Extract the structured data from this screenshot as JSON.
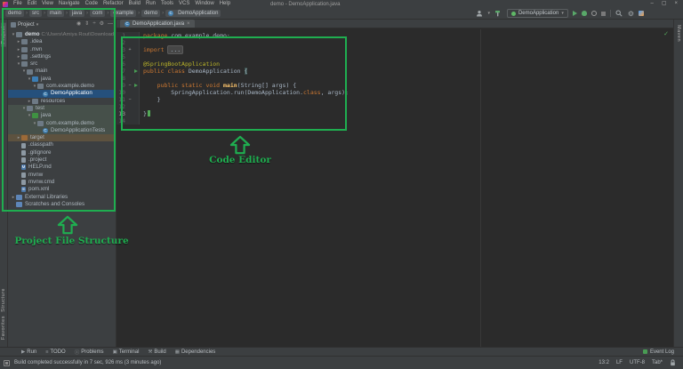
{
  "window": {
    "title": "demo - DemoApplication.java",
    "controls": [
      "minimize",
      "maximize",
      "close"
    ]
  },
  "menu": {
    "items": [
      "File",
      "Edit",
      "View",
      "Navigate",
      "Code",
      "Refactor",
      "Build",
      "Run",
      "Tools",
      "VCS",
      "Window",
      "Help"
    ]
  },
  "breadcrumbs": [
    "demo",
    "src",
    "main",
    "java",
    "com",
    "example",
    "demo",
    "DemoApplication"
  ],
  "toolbar": {
    "run_config": "DemoApplication",
    "icons": [
      "user",
      "build-hammer",
      "run",
      "debug",
      "coverage",
      "stop",
      "search",
      "settings",
      "plugins"
    ]
  },
  "left_stripe": {
    "top": "Project",
    "bottom": [
      "Structure",
      "Favorites"
    ]
  },
  "right_stripe": {
    "top": "Maven"
  },
  "project_panel": {
    "header": "Project",
    "header_icons": [
      "locate",
      "expand",
      "collapse",
      "settings",
      "hide"
    ],
    "tree": [
      {
        "label": "demo",
        "path": "C:\\Users\\Amiya Rout\\Downloads\\demo",
        "icon": "folder",
        "indent": 0,
        "chevron": "open",
        "bold": true
      },
      {
        "label": ".idea",
        "icon": "folder",
        "indent": 1,
        "chevron": "closed"
      },
      {
        "label": ".mvn",
        "icon": "folder",
        "indent": 1,
        "chevron": "closed"
      },
      {
        "label": ".settings",
        "icon": "folder",
        "indent": 1,
        "chevron": "closed"
      },
      {
        "label": "src",
        "icon": "folder",
        "indent": 1,
        "chevron": "open"
      },
      {
        "label": "main",
        "icon": "folder",
        "indent": 2,
        "chevron": "open"
      },
      {
        "label": "java",
        "icon": "folder-src",
        "indent": 3,
        "chevron": "open"
      },
      {
        "label": "com.example.demo",
        "icon": "package",
        "indent": 4,
        "chevron": "open"
      },
      {
        "label": "DemoApplication",
        "icon": "class",
        "indent": 5,
        "selected": true
      },
      {
        "label": "resources",
        "icon": "folder",
        "indent": 3,
        "chevron": "closed"
      },
      {
        "label": "test",
        "icon": "folder",
        "indent": 2,
        "chevron": "open",
        "tint": "test"
      },
      {
        "label": "java",
        "icon": "folder-test",
        "indent": 3,
        "chevron": "open",
        "tint": "test"
      },
      {
        "label": "com.example.demo",
        "icon": "package",
        "indent": 4,
        "chevron": "open",
        "tint": "test"
      },
      {
        "label": "DemoApplicationTests",
        "icon": "class",
        "indent": 5,
        "tint": "test"
      },
      {
        "label": "target",
        "icon": "folder-excluded",
        "indent": 1,
        "chevron": "closed",
        "tint": "excluded"
      },
      {
        "label": ".classpath",
        "icon": "file",
        "indent": 1
      },
      {
        "label": ".gitignore",
        "icon": "file",
        "indent": 1
      },
      {
        "label": ".project",
        "icon": "file",
        "indent": 1
      },
      {
        "label": "HELP.md",
        "icon": "file-md",
        "indent": 1
      },
      {
        "label": "mvnw",
        "icon": "file",
        "indent": 1
      },
      {
        "label": "mvnw.cmd",
        "icon": "file-cmd",
        "indent": 1
      },
      {
        "label": "pom.xml",
        "icon": "file-pom",
        "indent": 1
      },
      {
        "label": "External Libraries",
        "icon": "libraries",
        "indent": 0,
        "chevron": "closed"
      },
      {
        "label": "Scratches and Consoles",
        "icon": "scratches",
        "indent": 0
      }
    ]
  },
  "editor": {
    "tab": "DemoApplication.java",
    "tab_close": "×",
    "inspection_status": "✓",
    "cursor_position": "13:2",
    "lines": [
      {
        "num": "1",
        "tokens": [
          [
            "kw",
            "package "
          ],
          [
            "pl",
            "com.example.demo;"
          ]
        ]
      },
      {
        "num": "2",
        "tokens": []
      },
      {
        "num": "3",
        "fold": "plus",
        "tokens": [
          [
            "kw",
            "import "
          ],
          [
            "fold",
            "..."
          ]
        ]
      },
      {
        "num": "5",
        "tokens": []
      },
      {
        "num": "6",
        "tokens": [
          [
            "ann",
            "@SpringBootApplication"
          ]
        ]
      },
      {
        "num": "7",
        "run": true,
        "tokens": [
          [
            "kw",
            "public class "
          ],
          [
            "pl",
            "DemoApplication "
          ],
          [
            "brace",
            "{"
          ]
        ]
      },
      {
        "num": "8",
        "tokens": []
      },
      {
        "num": "9",
        "run": true,
        "fold": "minus",
        "tokens": [
          [
            "pl",
            "    "
          ],
          [
            "kw",
            "public static void "
          ],
          [
            "method",
            "main"
          ],
          [
            "pl",
            "(String[] args) {"
          ]
        ]
      },
      {
        "num": "10",
        "tokens": [
          [
            "pl",
            "        SpringApplication.run(DemoApplication."
          ],
          [
            "kw",
            "class"
          ],
          [
            "pl",
            ", args);"
          ]
        ]
      },
      {
        "num": "11",
        "fold": "minus",
        "tokens": [
          [
            "pl",
            "    }"
          ]
        ]
      },
      {
        "num": "12",
        "tokens": []
      },
      {
        "num": "13",
        "cursor": true,
        "tokens": [
          [
            "pl",
            "}"
          ]
        ]
      },
      {
        "num": "14",
        "tokens": []
      }
    ]
  },
  "bottom_bar": {
    "left": [
      {
        "icon": "play",
        "label": "Run"
      },
      {
        "icon": "todo",
        "label": "TODO"
      },
      {
        "icon": "problems",
        "label": "Problems"
      },
      {
        "icon": "terminal",
        "label": "Terminal"
      },
      {
        "icon": "build",
        "label": "Build"
      },
      {
        "icon": "dependencies",
        "label": "Dependencies"
      }
    ],
    "right": {
      "icon": "event-log",
      "label": "Event Log"
    }
  },
  "status_bar": {
    "message": "Build completed successfully in 7 sec, 926 ms (3 minutes ago)",
    "caret": "13:2",
    "line_ending": "LF",
    "encoding": "UTF-8",
    "indent": "Tab*"
  },
  "annotations": {
    "color": "#1fae50",
    "box1_label": "Project File Structure",
    "box2_label": "Code Editor"
  },
  "colors": {
    "annotation_green": "#1fae50",
    "keyword_orange": "#cc7832",
    "annotation_yellow": "#bbb529",
    "run_green": "#499c54",
    "selection_blue": "#25507c",
    "editor_bg": "#2b2b2b",
    "panel_bg": "#3c3f41"
  }
}
